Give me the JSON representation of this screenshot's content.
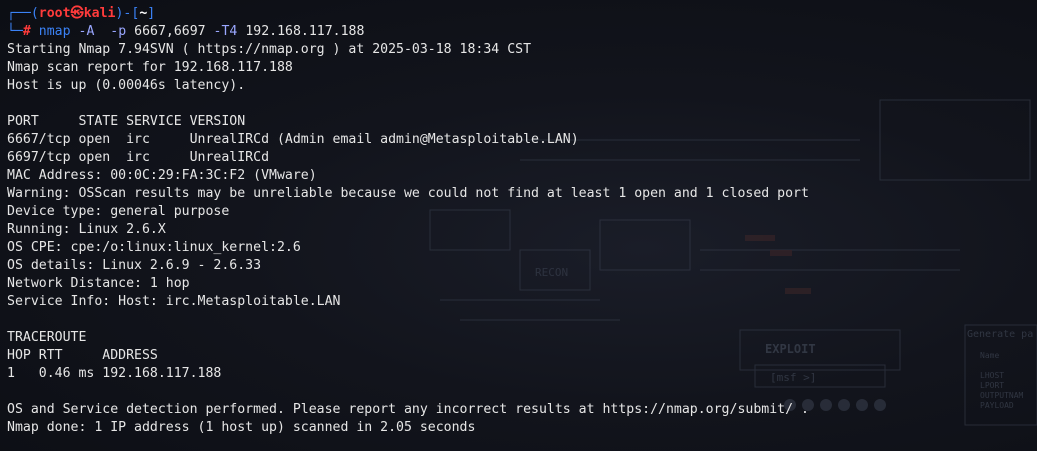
{
  "prompt": {
    "corner_top": "┌──(",
    "user": "root㉿kali",
    "mid": ")-[",
    "path": "~",
    "end": "]",
    "corner_bottom": "└─",
    "hash": "# ",
    "command": "nmap",
    "flag_a": "-A",
    "flag_p": "-p",
    "ports": "6667,6697",
    "flag_t": "-T4",
    "target": "192.168.117.188"
  },
  "output": [
    "Starting Nmap 7.94SVN ( https://nmap.org ) at 2025-03-18 18:34 CST",
    "Nmap scan report for 192.168.117.188",
    "Host is up (0.00046s latency).",
    "",
    "PORT     STATE SERVICE VERSION",
    "6667/tcp open  irc     UnrealIRCd (Admin email admin@Metasploitable.LAN)",
    "6697/tcp open  irc     UnrealIRCd",
    "MAC Address: 00:0C:29:FA:3C:F2 (VMware)",
    "Warning: OSScan results may be unreliable because we could not find at least 1 open and 1 closed port",
    "Device type: general purpose",
    "Running: Linux 2.6.X",
    "OS CPE: cpe:/o:linux:linux_kernel:2.6",
    "OS details: Linux 2.6.9 - 2.6.33",
    "Network Distance: 1 hop",
    "Service Info: Host: irc.Metasploitable.LAN",
    "",
    "TRACEROUTE",
    "HOP RTT     ADDRESS",
    "1   0.46 ms 192.168.117.188",
    "",
    "OS and Service detection performed. Please report any incorrect results at https://nmap.org/submit/ .",
    "Nmap done: 1 IP address (1 host up) scanned in 2.05 seconds"
  ],
  "wallpaper": {
    "recon_label": "RECON",
    "exploit_label": "EXPLOIT",
    "msf_label": "[msf >]",
    "generate_label": "Generate pa",
    "name_label": "Name",
    "lhost_label": "LHOST",
    "lport_label": "LPORT",
    "output_label": "OUTPUTNAM",
    "payload_label": "PAYLOAD"
  },
  "colors": {
    "background": "#0d0f16",
    "text": "#e6e6e6",
    "prompt_frame": "#3b82f6",
    "prompt_user": "#ff3b3b"
  }
}
